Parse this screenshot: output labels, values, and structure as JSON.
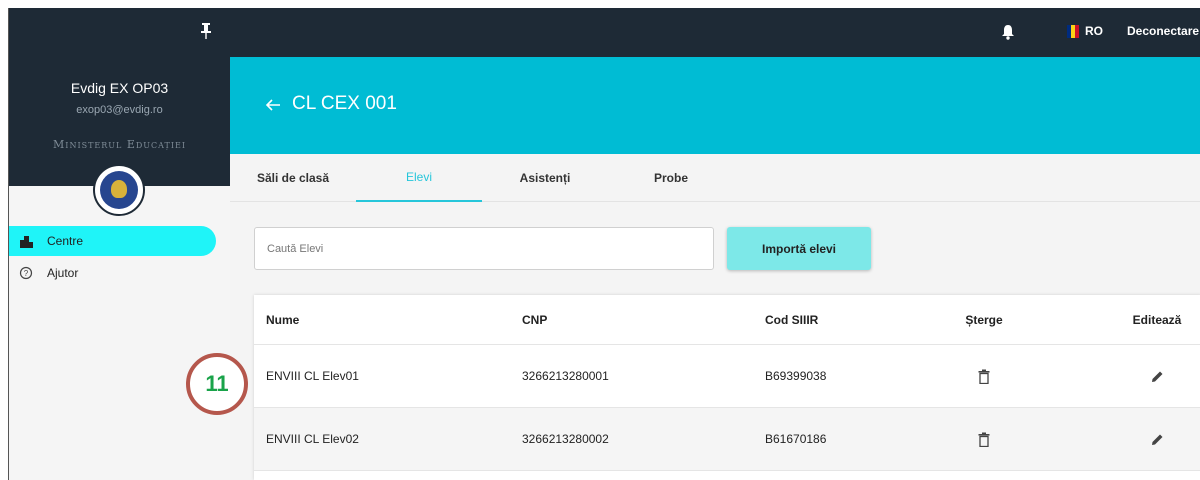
{
  "topbar": {
    "pin_icon": "pin-icon",
    "bell_icon": "bell-icon",
    "flag_colors": [
      "#002b7f",
      "#fcd116",
      "#ce1126"
    ],
    "language": "RO",
    "logout_label": "Deconectare"
  },
  "sidebar": {
    "user_name": "Evdig EX OP03",
    "user_email": "exop03@evdig.ro",
    "ministry": "Ministerul Educației",
    "items": [
      {
        "label": "Centre",
        "icon": "building-icon",
        "active": true
      },
      {
        "label": "Ajutor",
        "icon": "help-circle-icon",
        "active": false
      }
    ]
  },
  "header": {
    "back_icon": "arrow-left-icon",
    "title": "CL CEX 001",
    "color": "#00bcd4"
  },
  "tabs": [
    {
      "label": "Săli de clasă"
    },
    {
      "label": "Elevi",
      "active": true
    },
    {
      "label": "Asistenți"
    },
    {
      "label": "Probe"
    }
  ],
  "search": {
    "placeholder": "Caută Elevi",
    "value": ""
  },
  "import_button": "Importă elevi",
  "table": {
    "columns": [
      "Nume",
      "CNP",
      "Cod SIIIR",
      "Șterge",
      "Editează"
    ],
    "rows": [
      {
        "nume": "ENVIII CL Elev01",
        "cnp": "3266213280001",
        "cod": "B69399038"
      },
      {
        "nume": "ENVIII CL Elev02",
        "cnp": "3266213280002",
        "cod": "B61670186"
      }
    ]
  },
  "annotation_badge": "11"
}
